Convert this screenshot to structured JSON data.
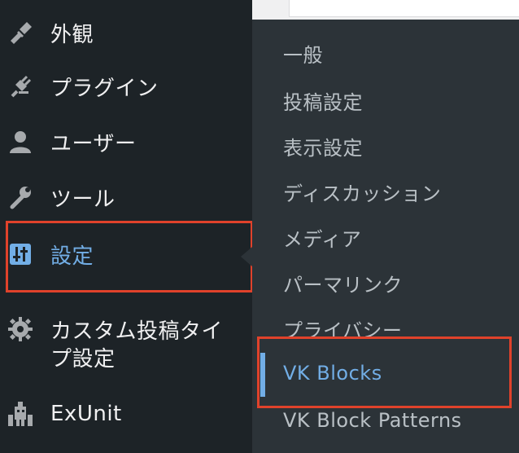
{
  "menu": {
    "items": [
      {
        "label": "外観",
        "icon": "paintbrush-icon"
      },
      {
        "label": "プラグイン",
        "icon": "plugin-icon"
      },
      {
        "label": "ユーザー",
        "icon": "user-icon"
      },
      {
        "label": "ツール",
        "icon": "wrench-icon"
      },
      {
        "label": "設定",
        "icon": "settings-sliders-icon",
        "current": true
      },
      {
        "label": "カスタム投稿タイ",
        "icon": "gear-icon"
      },
      {
        "label": "プ設定",
        "icon": ""
      },
      {
        "label": "ExUnit",
        "icon": "exunit-icon"
      }
    ]
  },
  "submenu": {
    "items": [
      {
        "label": "一般"
      },
      {
        "label": "投稿設定"
      },
      {
        "label": "表示設定"
      },
      {
        "label": "ディスカッション"
      },
      {
        "label": "メディア"
      },
      {
        "label": "パーマリンク"
      },
      {
        "label": "プライバシー"
      },
      {
        "label": "VK Blocks",
        "current": true
      },
      {
        "label": "VK Block Patterns"
      }
    ]
  },
  "colors": {
    "sidebar_bg": "#1d2327",
    "submenu_bg": "#2c3338",
    "text": "#f0f0f1",
    "accent": "#72aee6",
    "highlight": "#e0422b"
  }
}
